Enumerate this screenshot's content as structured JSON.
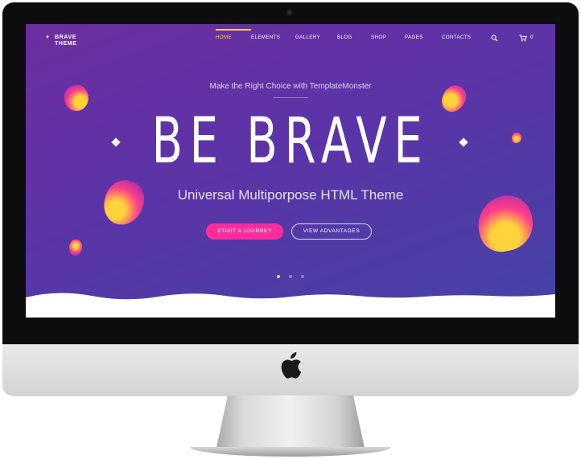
{
  "site": {
    "logo": {
      "line1": "BRAVE",
      "line2": "THEME",
      "icon": "gem-icon"
    },
    "nav": {
      "items": [
        {
          "label": "HOME",
          "active": true
        },
        {
          "label": "ELEMENTS",
          "active": false
        },
        {
          "label": "GALLERY",
          "active": false
        },
        {
          "label": "BLOG",
          "active": false
        },
        {
          "label": "SHOP",
          "active": false
        },
        {
          "label": "PAGES",
          "active": false
        },
        {
          "label": "CONTACTS",
          "active": false
        }
      ],
      "search_icon": "search-icon",
      "cart_icon": "cart-icon",
      "cart_count": "0"
    },
    "hero": {
      "tagline": "Make the Right Choice with TemplateMonster",
      "headline": "BE BRAVE",
      "subtitle": "Universal Multiporpose HTML Theme",
      "primary_button": "START A JOURNEY",
      "secondary_button": "VIEW ADVANTAGES",
      "slides": {
        "count": 3,
        "active_index": 0
      }
    }
  },
  "colors": {
    "accent_pink": "#ff2d9b",
    "active_yellow": "#ffcf4a",
    "hero_start": "#6d2ea0",
    "hero_end": "#4443a6"
  }
}
